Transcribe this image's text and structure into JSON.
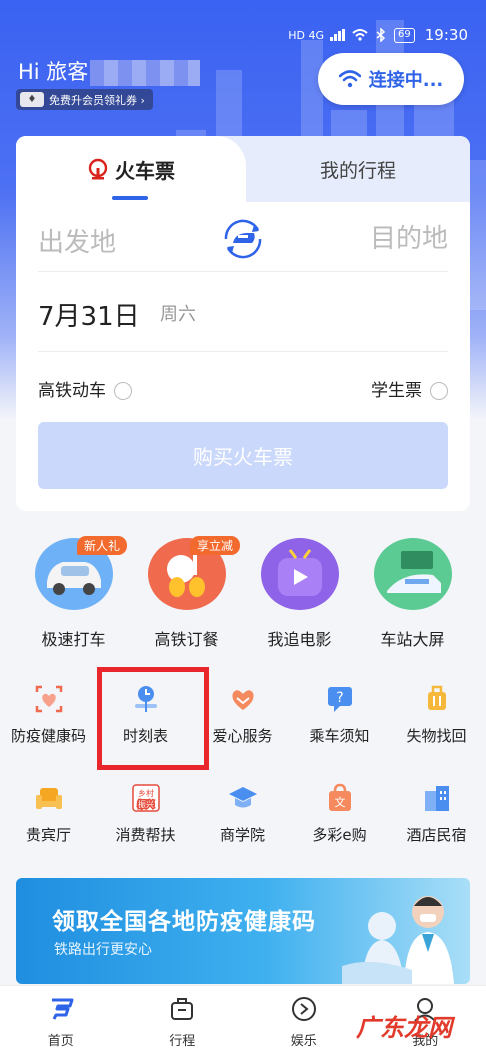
{
  "status_bar": {
    "signal_text": "HD 4G",
    "battery": "69",
    "time": "19:30"
  },
  "header": {
    "greeting": "Hi 旅客",
    "vip_badge": "免费升会员领礼券 ›",
    "wifi_button": "连接中..."
  },
  "ticket_card": {
    "tab_active": "火车票",
    "tab_other": "我的行程",
    "from_placeholder": "出发地",
    "to_placeholder": "目的地",
    "date": "7月31日",
    "weekday": "周六",
    "option_highspeed": "高铁动车",
    "option_student": "学生票",
    "buy_button": "购买火车票"
  },
  "big_services": [
    {
      "label": "极速打车",
      "tag": "新人礼"
    },
    {
      "label": "高铁订餐",
      "tag": "享立减"
    },
    {
      "label": "我追电影",
      "tag": ""
    },
    {
      "label": "车站大屏",
      "tag": ""
    }
  ],
  "small_services_row1": [
    {
      "label": "防疫健康码"
    },
    {
      "label": "时刻表"
    },
    {
      "label": "爱心服务"
    },
    {
      "label": "乘车须知"
    },
    {
      "label": "失物找回"
    }
  ],
  "small_services_row2": [
    {
      "label": "贵宾厅"
    },
    {
      "label": "消费帮扶",
      "icon_text": "乡村振兴"
    },
    {
      "label": "商学院"
    },
    {
      "label": "多彩e购"
    },
    {
      "label": "酒店民宿"
    }
  ],
  "banner": {
    "title": "领取全国各地防疫健康码",
    "subtitle": "铁路出行更安心"
  },
  "bottom_nav": [
    {
      "label": "首页"
    },
    {
      "label": "行程"
    },
    {
      "label": "娱乐"
    },
    {
      "label": "我的"
    }
  ],
  "watermark": "广东龙网",
  "colors": {
    "brand_blue": "#2f63e8",
    "highlight_red": "#e8262b",
    "tag_orange": "#f26a2e"
  }
}
